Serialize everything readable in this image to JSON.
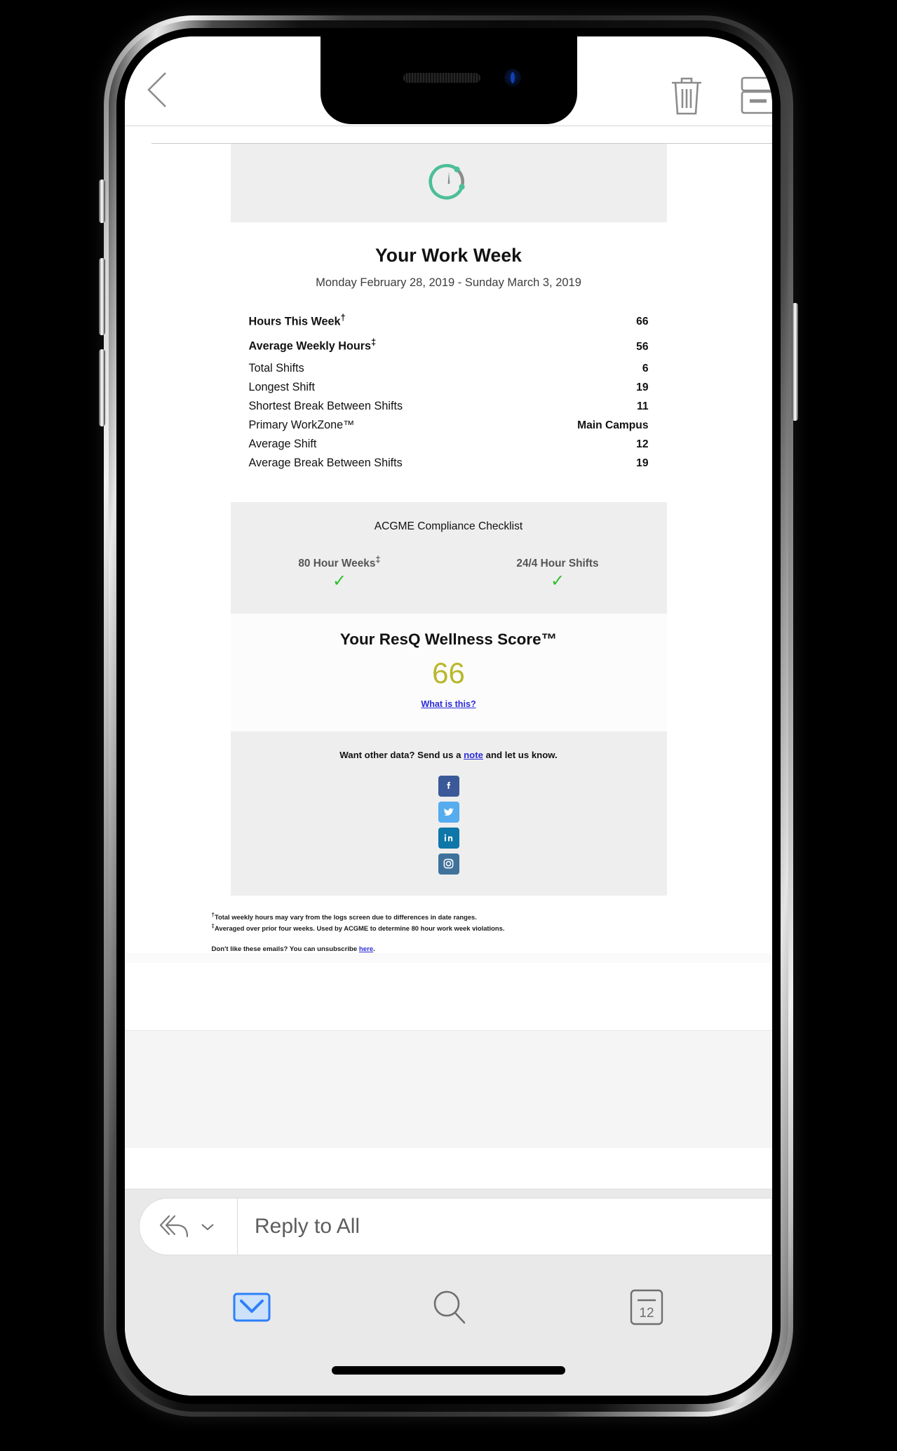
{
  "navbar": {
    "back_icon": "chevron-left-icon",
    "delete_icon": "trash-icon",
    "archive_icon": "archive-box-icon"
  },
  "email": {
    "logo_icon": "circular-gauge-logo",
    "title": "Your Work Week",
    "date_range": "Monday February 28, 2019 - Sunday March 3, 2019",
    "stats": [
      {
        "label": "Hours This Week",
        "sup": "†",
        "value": "66"
      },
      {
        "label": "Average Weekly Hours",
        "sup": "‡",
        "value": "56"
      },
      {
        "label": "Total Shifts",
        "sup": "",
        "value": "6"
      },
      {
        "label": "Longest Shift",
        "sup": "",
        "value": "19"
      },
      {
        "label": "Shortest Break Between Shifts",
        "sup": "",
        "value": "11"
      },
      {
        "label": "Primary WorkZone™",
        "sup": "",
        "value": "Main Campus"
      },
      {
        "label": "Average Shift",
        "sup": "",
        "value": "12"
      },
      {
        "label": "Average Break Between Shifts",
        "sup": "",
        "value": "19"
      }
    ],
    "acgme": {
      "title": "ACGME Compliance Checklist",
      "items": [
        {
          "name": "80 Hour Weeks",
          "sup": "‡",
          "status": "✓"
        },
        {
          "name": "24/4 Hour Shifts",
          "sup": "",
          "status": "✓"
        }
      ],
      "check_color": "#2fbf2f"
    },
    "wellness": {
      "title": "Your ResQ Wellness Score™",
      "score": "66",
      "score_color": "#b8b82a",
      "link_label": "What is this?"
    },
    "social": {
      "prompt_before": "Want other data? Send us a ",
      "prompt_link": "note",
      "prompt_after": " and let us know.",
      "icons": [
        {
          "name": "facebook-icon",
          "color": "#3b5998"
        },
        {
          "name": "twitter-icon",
          "color": "#55acee"
        },
        {
          "name": "linkedin-icon",
          "color": "#0e76a8"
        },
        {
          "name": "instagram-icon",
          "color": "#3f729b"
        }
      ]
    },
    "footnotes": {
      "note1_sup": "†",
      "note1": "Total weekly hours may vary from the logs screen due to differences in date ranges.",
      "note2_sup": "‡",
      "note2": "Averaged over prior four weeks. Used by ACGME to determine 80 hour work week violations.",
      "unsub_before": "Don't like these emails? You can unsubscribe ",
      "unsub_link": "here",
      "unsub_after": "."
    }
  },
  "reply": {
    "reply_all_icon": "reply-all-icon",
    "chevron_icon": "chevron-down-icon",
    "placeholder": "Reply to All"
  },
  "tabbar": {
    "items": [
      {
        "name": "mail-icon",
        "label": "Mail",
        "active": true
      },
      {
        "name": "search-icon",
        "label": "Search",
        "active": false
      },
      {
        "name": "calendar-icon",
        "label": "Calendar",
        "active": false
      }
    ],
    "calendar_day": "12",
    "active_color": "#2d7ff9"
  }
}
